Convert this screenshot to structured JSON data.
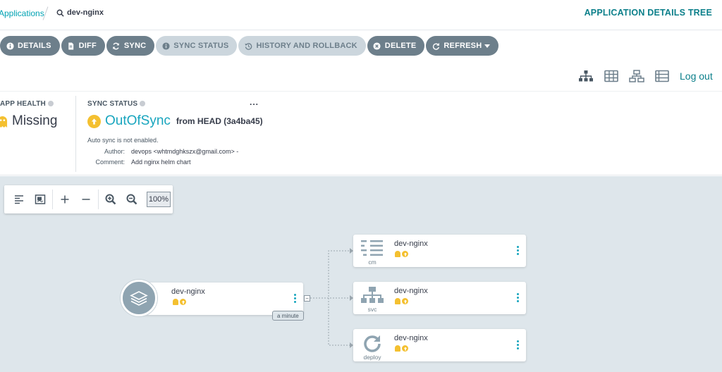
{
  "breadcrumb": {
    "applications": "Applications",
    "current": "dev-nginx"
  },
  "page_title": "APPLICATION DETAILS TREE",
  "actions": [
    {
      "label": "DETAILS",
      "icon": "info-icon",
      "enabled": true
    },
    {
      "label": "DIFF",
      "icon": "file-icon",
      "enabled": true
    },
    {
      "label": "SYNC",
      "icon": "sync-icon",
      "enabled": true
    },
    {
      "label": "SYNC STATUS",
      "icon": "info-icon",
      "enabled": false
    },
    {
      "label": "HISTORY AND ROLLBACK",
      "icon": "history-icon",
      "enabled": false
    },
    {
      "label": "DELETE",
      "icon": "times-circle-icon",
      "enabled": true
    },
    {
      "label": "REFRESH",
      "icon": "redo-icon",
      "enabled": true,
      "dropdown": true
    }
  ],
  "view_icons": [
    "tree-view-icon",
    "pods-view-icon",
    "network-view-icon",
    "list-view-icon"
  ],
  "logout": "Log out",
  "status": {
    "health_label": "APP HEALTH",
    "health_value": "Missing",
    "sync_label": "SYNC STATUS",
    "sync_value": "OutOfSync",
    "sync_from": "from HEAD (3a4ba45)",
    "more": "...",
    "auto_sync": "Auto sync is not enabled.",
    "author_key": "Author:",
    "author_value": "devops <whtmdghkszx@gmail.com> -",
    "comment_key": "Comment:",
    "comment_value": "Add nginx helm chart"
  },
  "zoom": {
    "level": "100%"
  },
  "tree": {
    "app": {
      "name": "dev-nginx",
      "age": "a minute"
    },
    "resources": [
      {
        "name": "dev-nginx",
        "kind": "cm",
        "icon": "configmap-icon"
      },
      {
        "name": "dev-nginx",
        "kind": "svc",
        "icon": "service-icon"
      },
      {
        "name": "dev-nginx",
        "kind": "deploy",
        "icon": "deployment-icon"
      }
    ]
  },
  "colors": {
    "accent": "#18a5be",
    "button": "#6d7f8b",
    "button_disabled": "#ccd6dd",
    "warning": "#f4c030",
    "canvas": "#dee6eb"
  }
}
